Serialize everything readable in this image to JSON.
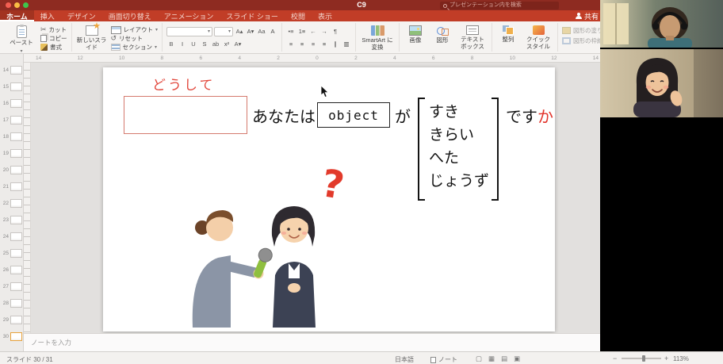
{
  "window": {
    "title": "C9",
    "search_placeholder": "プレゼンテーション内を検索",
    "share_label": "共有"
  },
  "tabs": [
    {
      "label": "ホーム",
      "cls": "active"
    },
    {
      "label": "挿入"
    },
    {
      "label": "デザイン"
    },
    {
      "label": "画面切り替え"
    },
    {
      "label": "アニメーション"
    },
    {
      "label": "スライド ショー"
    },
    {
      "label": "校閲"
    },
    {
      "label": "表示"
    }
  ],
  "ribbon": {
    "paste": "ペースト",
    "cut": "カット",
    "copy": "コピー",
    "format_painter": "書式",
    "new_slide": "新しいスライド",
    "layout": "レイアウト",
    "reset": "リセット",
    "section": "セクション",
    "smartart": "SmartArt に変換",
    "picture": "画像",
    "shapes": "図形",
    "textbox": "テキスト ボックス",
    "arrange": "整列",
    "quick_styles": "クイック スタイル",
    "shape_fill": "図形の塗りつぶし",
    "shape_outline": "図形の枠線",
    "dropdown": "▾"
  },
  "icons": {
    "font_row1": [
      "A▴",
      "A▾",
      "Aa",
      "A"
    ],
    "font_row2": [
      "B",
      "I",
      "U",
      "S",
      "ab",
      "x²",
      "A▾"
    ],
    "para_row1": [
      "•≡",
      "1≡",
      "←",
      "→",
      "¶"
    ],
    "para_row2": [
      "≡",
      "≡",
      "≡",
      "≡",
      "∥",
      "▥"
    ],
    "views": [
      "▢",
      "▦",
      "▤",
      "▣"
    ]
  },
  "ruler_numbers": [
    "14",
    "12",
    "10",
    "8",
    "6",
    "4",
    "2",
    "0",
    "2",
    "4",
    "6",
    "8",
    "10",
    "12",
    "14"
  ],
  "thumbnails": [
    {
      "num": "14"
    },
    {
      "num": "15"
    },
    {
      "num": "16"
    },
    {
      "num": "17"
    },
    {
      "num": "18"
    },
    {
      "num": "19"
    },
    {
      "num": "20"
    },
    {
      "num": "21"
    },
    {
      "num": "22"
    },
    {
      "num": "23"
    },
    {
      "num": "24"
    },
    {
      "num": "25"
    },
    {
      "num": "26"
    },
    {
      "num": "27"
    },
    {
      "num": "28"
    },
    {
      "num": "29"
    },
    {
      "num": "30",
      "cls": "selected"
    }
  ],
  "slide": {
    "prompt": "どうして",
    "subject": "あなたは",
    "object_label": "object",
    "particle": "が",
    "options": [
      "すき",
      "きらい",
      "へた",
      "じょうず"
    ],
    "copula": "です",
    "question_particle": "か",
    "question_mark": "?"
  },
  "notes_placeholder": "ノートを入力",
  "status": {
    "slide_counter": "スライド 30 / 31",
    "language": "日本語",
    "notes_label": "ノート",
    "zoom_minus": "−",
    "zoom_plus": "+",
    "zoom_percent": "113%"
  },
  "colors": {
    "titlebar": "#8e2b21",
    "ribbon_red": "#c13d27",
    "accent_red_text": "#e2493e",
    "selected_thumb": "#e8a33d"
  }
}
